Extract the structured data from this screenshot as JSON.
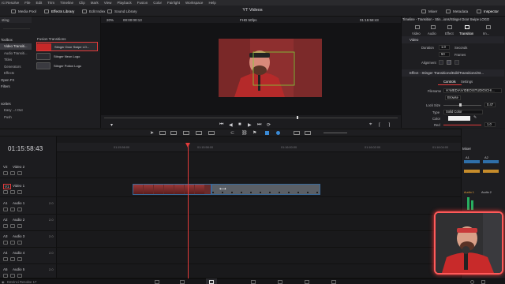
{
  "menu": {
    "items": [
      "rci Resolve",
      "File",
      "Edit",
      "Trim",
      "Timeline",
      "Clip",
      "Mark",
      "View",
      "Playback",
      "Fusion",
      "Color",
      "Fairlight",
      "Workspace",
      "Help"
    ]
  },
  "toolbar": {
    "media_pool": "Media Pool",
    "effects_library": "Effects Library",
    "edit_index": "Edit Index",
    "sound_library": "Sound Library",
    "project_title": "YT Videos",
    "mixer": "Mixer",
    "metadata": "Metadata",
    "inspector": "Inspector"
  },
  "left_panel": {
    "search_text": "sting",
    "tree": [
      {
        "label": "Toolbox",
        "type": "hdr"
      },
      {
        "label": "Video Transiti...",
        "type": "sel"
      },
      {
        "label": "Audio Transiti...",
        "type": "sub"
      },
      {
        "label": "Titles",
        "type": "sub"
      },
      {
        "label": "Generators",
        "type": "sub"
      },
      {
        "label": "Effects",
        "type": "sub"
      },
      {
        "label": "Open FX",
        "type": "hdr"
      },
      {
        "label": "Filters",
        "type": "hdr"
      }
    ],
    "favorites": {
      "header": "vorites",
      "items": [
        "Easy ...t Out",
        "Push"
      ]
    },
    "fusion_header": "Fusion Transitions",
    "fusion_items": [
      {
        "label": "Stinger Door Swipe LO...",
        "thumb_color": "#c62828",
        "selected": true
      },
      {
        "label": "Stinger Neon Logo",
        "thumb_color": "#2b2b30",
        "selected": false
      },
      {
        "label": "Stinger Potion Logo",
        "thumb_color": "#3a3a40",
        "selected": false
      }
    ]
  },
  "viewer": {
    "zoom": "20%",
    "timecode_left": "00:00:00:13",
    "format": "FHD 50fps",
    "timecode_right": "01:15:58:43"
  },
  "inspector": {
    "title": "Timeline - Transition - Stin...ions/Stinger Door Swipe LOGO",
    "tabs": [
      "Video",
      "Audio",
      "Effect",
      "Transition",
      "Im..."
    ],
    "active_tab": "Transition",
    "video_section": "Video",
    "duration_label": "Duration",
    "duration_value": "1.0",
    "duration_unit": "Seconds",
    "frames_value": "50",
    "frames_unit": "Frames",
    "alignment_label": "Alignment",
    "effect_section": "Effect - Stinger Transitions/Edit/Transitions/St...",
    "subtabs": [
      "Controls",
      "Settings"
    ],
    "filename_label": "Filename",
    "filename_value": "H:\\MEDIA\\VIDEO\\STUDIO\\CH\\...",
    "browse_label": "Browse",
    "lock_label": "Lock Size",
    "lock_value": "0.47",
    "type_label": "Type",
    "type_value": "Solid Color",
    "color_label": "Color",
    "red_label": "Red",
    "red_value": "1.0"
  },
  "timeline": {
    "timecode": "01:15:58:43",
    "ruler_ticks": [
      "01:15:56:00",
      "01:15:58:00",
      "01:16:00:00",
      "01:16:02:00",
      "01:16:04:00"
    ],
    "tracks": [
      {
        "id": "V2",
        "name": "Video 2",
        "type": "video"
      },
      {
        "id": "V1",
        "name": "Video 1",
        "type": "video"
      },
      {
        "id": "A1",
        "name": "Audio 1",
        "type": "audio",
        "level": "2.0"
      },
      {
        "id": "A2",
        "name": "Audio 2",
        "type": "audio",
        "level": "2.0"
      },
      {
        "id": "A3",
        "name": "Audio 3",
        "type": "audio",
        "level": "2.0"
      },
      {
        "id": "A4",
        "name": "Audio 4",
        "type": "audio",
        "level": "2.0"
      },
      {
        "id": "A5",
        "name": "Audio 5",
        "type": "audio",
        "level": "2.0"
      }
    ]
  },
  "mixer": {
    "title": "Mixer",
    "channels": [
      "A1",
      "A2"
    ],
    "channel_labels": [
      "Audio 1",
      "Audio 2"
    ]
  },
  "bottom": {
    "app_name": "DaVinci Resolve 17"
  },
  "colors": {
    "accent_red": "#e33b3b",
    "selection_blue": "#3a6a9a",
    "meter_green": "#27ae60",
    "webcam_border": "#ff5a5a"
  }
}
